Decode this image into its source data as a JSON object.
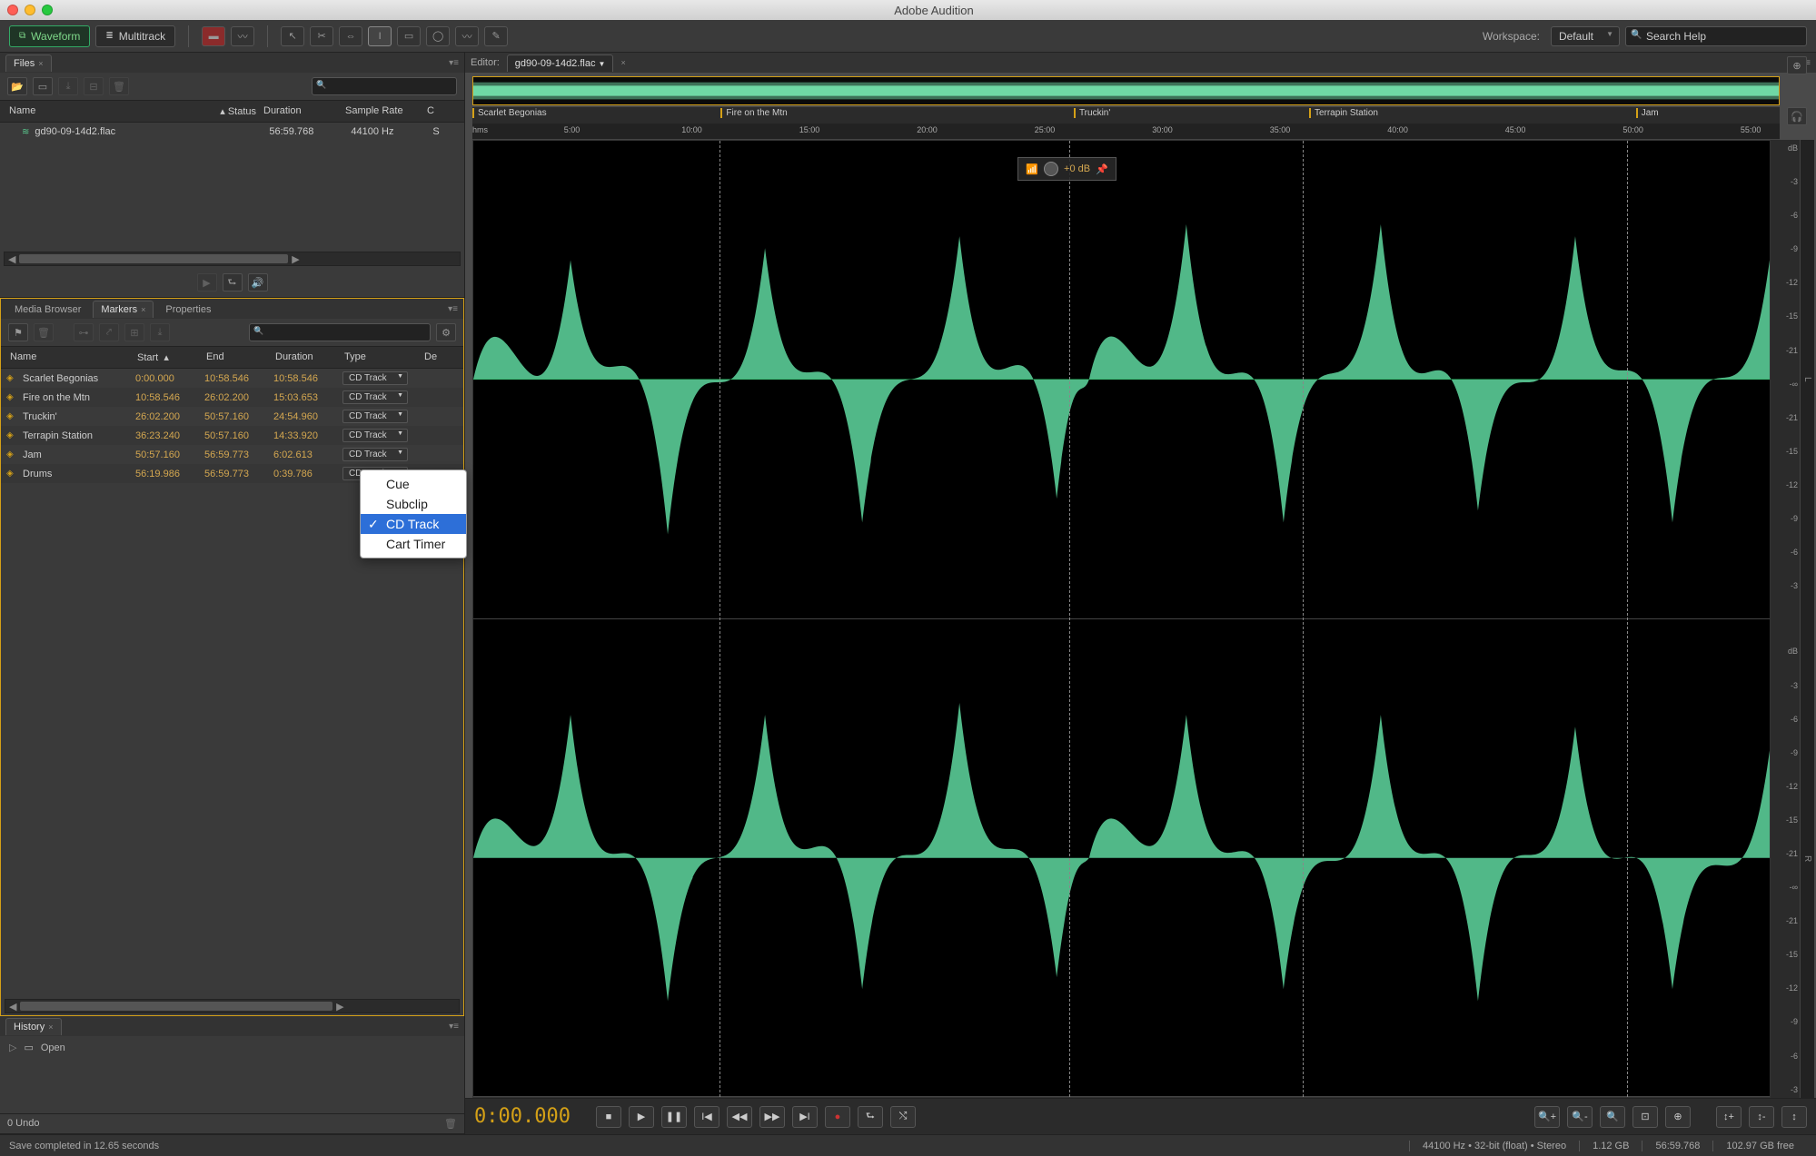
{
  "app": {
    "title": "Adobe Audition"
  },
  "toolbar": {
    "waveform": "Waveform",
    "multitrack": "Multitrack",
    "workspace_label": "Workspace:",
    "workspace_value": "Default",
    "search_placeholder": "Search Help"
  },
  "files": {
    "tab": "Files",
    "cols": {
      "name": "Name",
      "status": "Status",
      "duration": "Duration",
      "samplerate": "Sample Rate",
      "channels": "C"
    },
    "row": {
      "name": "gd90-09-14d2.flac",
      "duration": "56:59.768",
      "samplerate": "44100 Hz",
      "channels": "S"
    }
  },
  "tabs2": {
    "media": "Media Browser",
    "markers": "Markers",
    "properties": "Properties"
  },
  "markers_cols": {
    "name": "Name",
    "start": "Start",
    "end": "End",
    "duration": "Duration",
    "type": "Type",
    "desc": "De"
  },
  "markers": [
    {
      "name": "Scarlet Begonias",
      "start": "0:00.000",
      "end": "10:58.546",
      "duration": "10:58.546",
      "type": "CD Track"
    },
    {
      "name": "Fire on the Mtn",
      "start": "10:58.546",
      "end": "26:02.200",
      "duration": "15:03.653",
      "type": "CD Track"
    },
    {
      "name": "Truckin'",
      "start": "26:02.200",
      "end": "50:57.160",
      "duration": "24:54.960",
      "type": "CD Track"
    },
    {
      "name": "Terrapin Station",
      "start": "36:23.240",
      "end": "50:57.160",
      "duration": "14:33.920",
      "type": "CD Track"
    },
    {
      "name": "Jam",
      "start": "50:57.160",
      "end": "56:59.773",
      "duration": "6:02.613",
      "type": "CD Track"
    },
    {
      "name": "Drums",
      "start": "56:19.986",
      "end": "56:59.773",
      "duration": "0:39.786",
      "type": "CD Track"
    }
  ],
  "popup": {
    "items": [
      "Cue",
      "Subclip",
      "CD Track",
      "Cart Timer"
    ],
    "selected": "CD Track"
  },
  "history": {
    "tab": "History",
    "open": "Open",
    "undo": "0 Undo"
  },
  "editor": {
    "label": "Editor:",
    "file": "gd90-09-14d2.flac",
    "gain": "+0 dB",
    "timecode": "0:00.000",
    "ruler_label": "hms",
    "ruler": [
      "5:00",
      "10:00",
      "15:00",
      "20:00",
      "25:00",
      "30:00",
      "35:00",
      "40:00",
      "45:00",
      "50:00",
      "55:00"
    ],
    "db": [
      "dB",
      "-3",
      "-6",
      "-9",
      "-12",
      "-15",
      "-21",
      "-∞",
      "-21",
      "-15",
      "-12",
      "-9",
      "-6",
      "-3"
    ],
    "L": "L",
    "R": "R"
  },
  "status": {
    "msg": "Save completed in 12.65 seconds",
    "format": "44100 Hz • 32-bit (float) • Stereo",
    "size": "1.12 GB",
    "dur": "56:59.768",
    "free": "102.97 GB free"
  }
}
